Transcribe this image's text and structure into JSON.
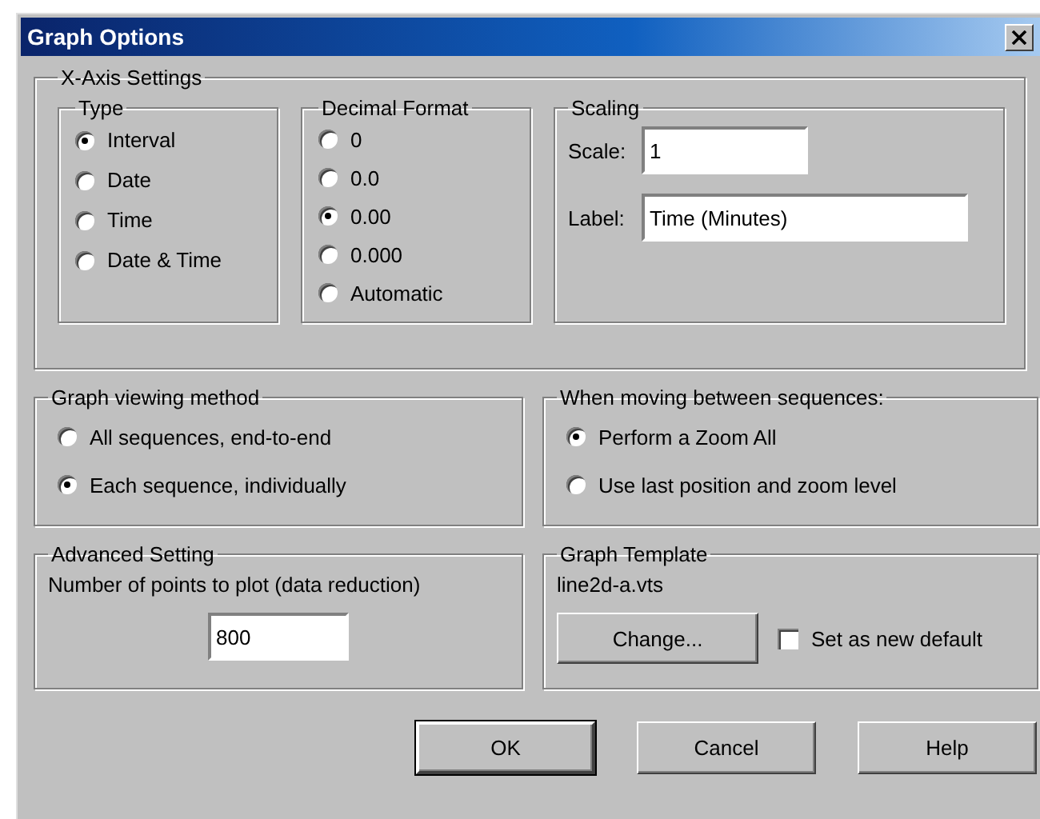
{
  "window": {
    "title": "Graph Options"
  },
  "x_axis": {
    "title": "X-Axis Settings",
    "type": {
      "title": "Type",
      "options": [
        {
          "label": "Interval",
          "selected": true
        },
        {
          "label": "Date",
          "selected": false
        },
        {
          "label": "Time",
          "selected": false
        },
        {
          "label": "Date & Time",
          "selected": false
        }
      ]
    },
    "decimal_format": {
      "title": "Decimal Format",
      "options": [
        {
          "label": "0",
          "selected": false
        },
        {
          "label": "0.0",
          "selected": false
        },
        {
          "label": "0.00",
          "selected": true
        },
        {
          "label": "0.000",
          "selected": false
        },
        {
          "label": "Automatic",
          "selected": false
        }
      ]
    },
    "scaling": {
      "title": "Scaling",
      "scale": {
        "label": "Scale:",
        "value": "1"
      },
      "label": {
        "label": "Label:",
        "value": "Time (Minutes)"
      }
    }
  },
  "viewing": {
    "title": "Graph viewing method",
    "options": [
      {
        "label": "All sequences, end-to-end",
        "selected": false
      },
      {
        "label": "Each sequence, individually",
        "selected": true
      }
    ]
  },
  "moving": {
    "title": "When moving between sequences:",
    "options": [
      {
        "label": "Perform a Zoom All",
        "selected": true
      },
      {
        "label": "Use last position and zoom level",
        "selected": false
      }
    ]
  },
  "advanced": {
    "title": "Advanced Setting",
    "label": "Number of points to plot (data reduction)",
    "value": "800"
  },
  "template": {
    "title": "Graph Template",
    "file": "line2d-a.vts",
    "change_button": "Change...",
    "set_default": {
      "label": "Set as new default",
      "checked": false
    }
  },
  "buttons": [
    {
      "label": "OK",
      "default": true
    },
    {
      "label": "Cancel",
      "default": false
    },
    {
      "label": "Help",
      "default": false
    }
  ]
}
